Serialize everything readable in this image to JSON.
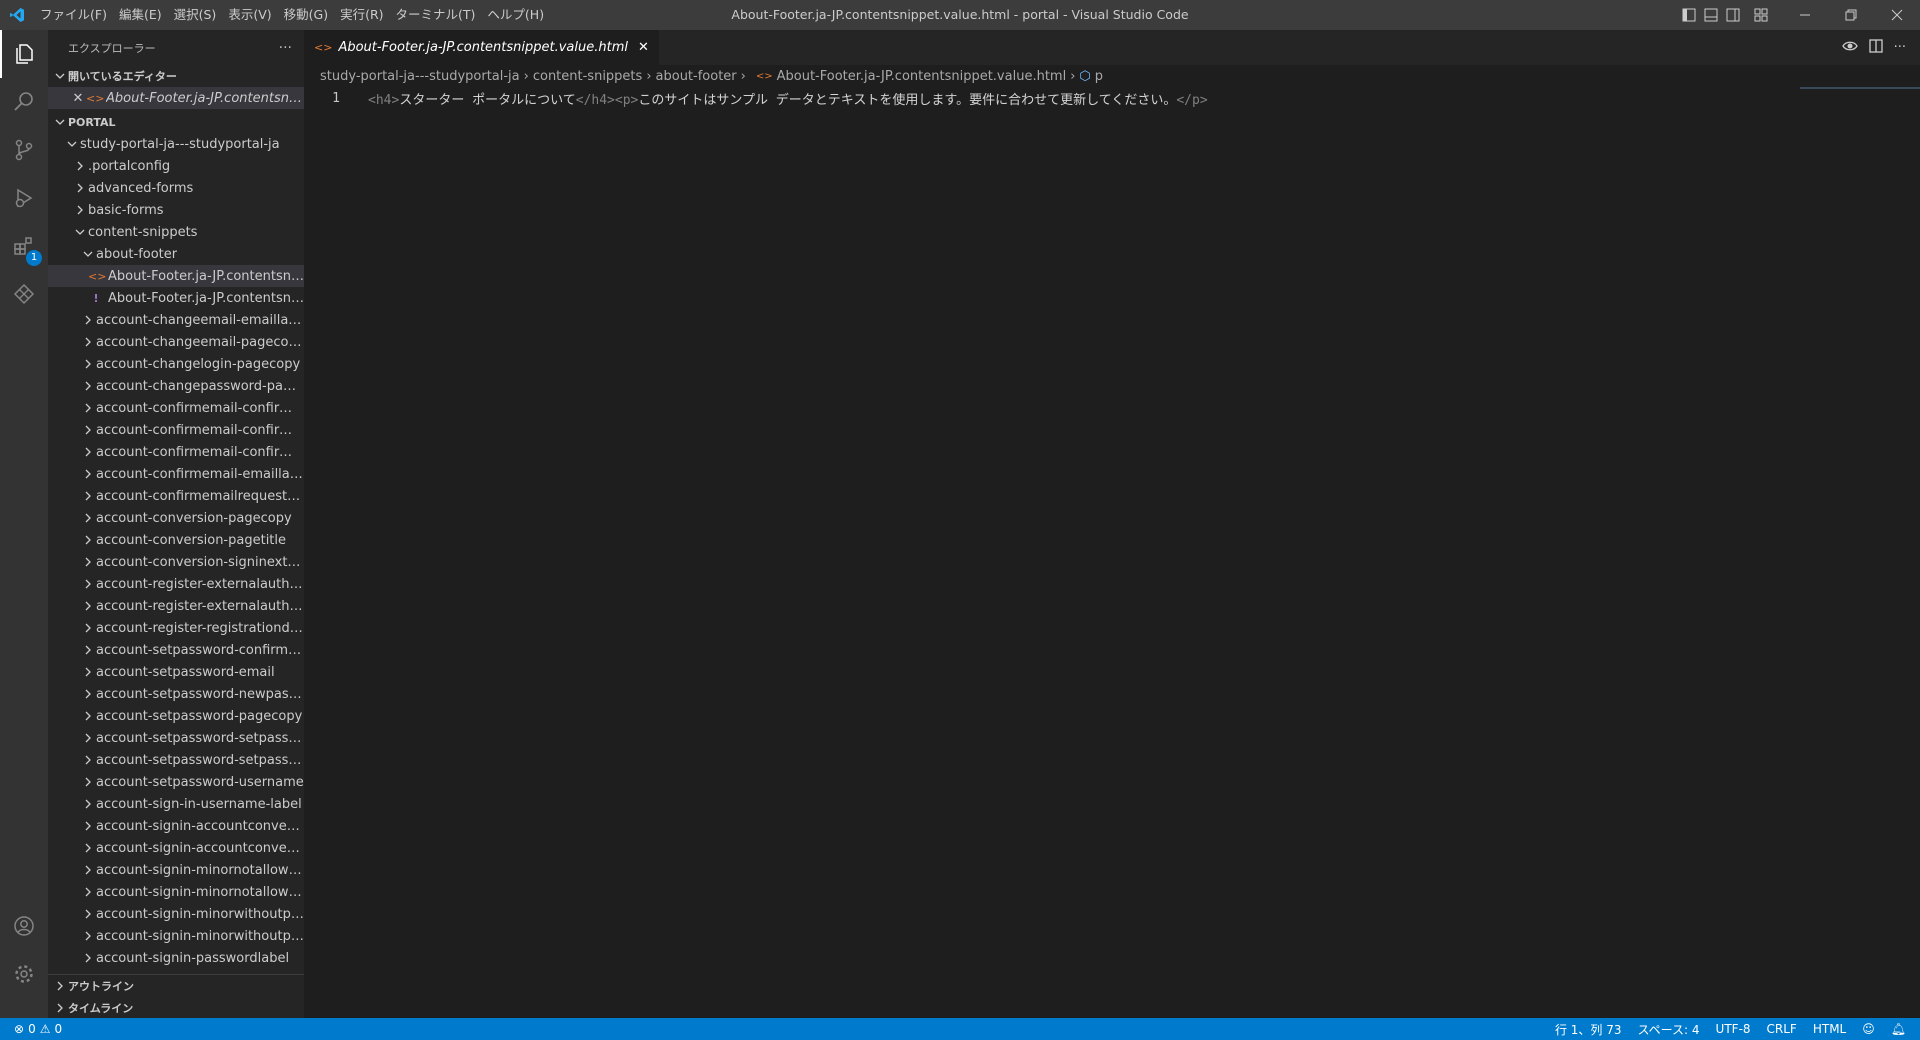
{
  "window": {
    "title": "About-Footer.ja-JP.contentsnippet.value.html - portal - Visual Studio Code"
  },
  "menu": [
    "ファイル(F)",
    "編集(E)",
    "選択(S)",
    "表示(V)",
    "移動(G)",
    "実行(R)",
    "ターミナル(T)",
    "ヘルプ(H)"
  ],
  "activity": {
    "extensions_badge": "1"
  },
  "sidebar": {
    "title": "エクスプローラー",
    "more": "···",
    "open_editors_label": "開いているエディター",
    "open_editor_file": "About-Footer.ja-JP.contentsnippet.value.html",
    "portal_label": "PORTAL",
    "root_folder": "study-portal-ja---studyportal-ja",
    "folders": [
      ".portalconfig",
      "advanced-forms",
      "basic-forms"
    ],
    "content_snippets": "content-snippets",
    "about_footer": "about-footer",
    "about_files": [
      "About-Footer.ja-JP.contentsnippet.value.html",
      "About-Footer.ja-JP.contentsnippet.yml"
    ],
    "snippet_folders": [
      "account-changeemail-emaillabel",
      "account-changeemail-pagecopy",
      "account-changelogin-pagecopy",
      "account-changepassword-pagecopy",
      "account-confirmemail-confirmemail",
      "account-confirmemail-confirmemail",
      "account-confirmemail-confirmemail",
      "account-confirmemail-emaillabel",
      "account-confirmemailrequest-pagecopy",
      "account-conversion-pagecopy",
      "account-conversion-pagetitle",
      "account-conversion-signinexternal",
      "account-register-externalauthentication",
      "account-register-externalauthentication",
      "account-register-registrationdisabled",
      "account-setpassword-confirmpassword",
      "account-setpassword-email",
      "account-setpassword-newpassword",
      "account-setpassword-pagecopy",
      "account-setpassword-setpassword",
      "account-setpassword-setpassword",
      "account-setpassword-username",
      "account-sign-in-username-label",
      "account-signin-accountconversion",
      "account-signin-accountconversion",
      "account-signin-minornotallowedcontent",
      "account-signin-minornotallowedheader",
      "account-signin-minorwithoutparent",
      "account-signin-minorwithoutparent",
      "account-signin-passwordlabel"
    ],
    "outline_label": "アウトライン",
    "timeline_label": "タイムライン"
  },
  "editor": {
    "tab_label": "About-Footer.ja-JP.contentsnippet.value.html",
    "breadcrumbs": [
      "study-portal-ja---studyportal-ja",
      "content-snippets",
      "about-footer",
      "About-Footer.ja-JP.contentsnippet.value.html",
      "p"
    ],
    "line_number": "1",
    "code": {
      "h4_open": "<h4>",
      "h4_text": "スターター ポータルについて",
      "h4_close": "</h4>",
      "p_open": "<p>",
      "p_text": "このサイトはサンプル データとテキストを使用します。要件に合わせて更新してください。",
      "p_close": "</p>"
    }
  },
  "status": {
    "errors": "0",
    "warnings": "0",
    "position": "行 1、列 73",
    "spaces": "スペース: 4",
    "encoding": "UTF-8",
    "eol": "CRLF",
    "language": "HTML"
  },
  "colors": {
    "accent": "#007acc",
    "activity_bar": "#333333",
    "sidebar": "#252526",
    "editor": "#1e1e1e"
  }
}
